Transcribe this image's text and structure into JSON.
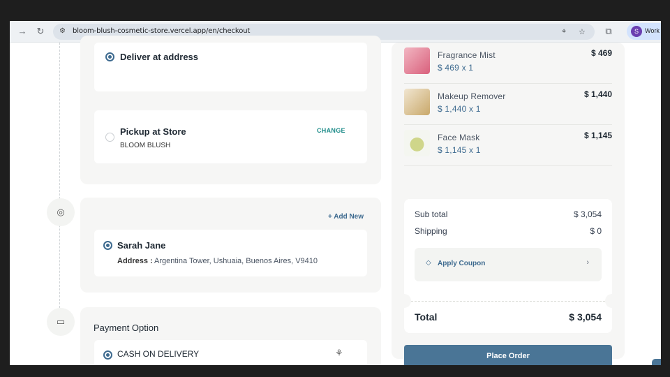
{
  "browser": {
    "url": "bloom-blush-cosmetic-store.vercel.app/en/checkout",
    "profile_initial": "S",
    "profile_label": "Work"
  },
  "delivery": {
    "deliver_label": "Deliver at address",
    "pickup_label": "Pickup at Store",
    "pickup_store": "BLOOM BLUSH",
    "change_label": "CHANGE"
  },
  "address": {
    "add_new_label": "+ Add New",
    "name": "Sarah Jane",
    "address_label": "Address :",
    "address_value": "Argentina Tower, Ushuaia, Buenos Aires, V9410"
  },
  "payment": {
    "title": "Payment Option",
    "method": "CASH ON DELIVERY"
  },
  "order": {
    "items": [
      {
        "name": "Fragrance Mist",
        "sub": "$ 469 x 1",
        "price": "$ 469",
        "color": "#e58fa3"
      },
      {
        "name": "Makeup Remover",
        "sub": "$ 1,440 x 1",
        "price": "$ 1,440",
        "color": "#e9d7b8"
      },
      {
        "name": "Face Mask",
        "sub": "$ 1,145 x 1",
        "price": "$ 1,145",
        "color": "#e8eee2"
      }
    ],
    "subtotal_label": "Sub total",
    "subtotal_value": "$ 3,054",
    "shipping_label": "Shipping",
    "shipping_value": "$ 0",
    "coupon_label": "Apply Coupon",
    "total_label": "Total",
    "total_value": "$ 3,054",
    "place_order_label": "Place Order"
  },
  "colors": {
    "accent": "#4a7596",
    "teal": "#1e8c8a"
  }
}
